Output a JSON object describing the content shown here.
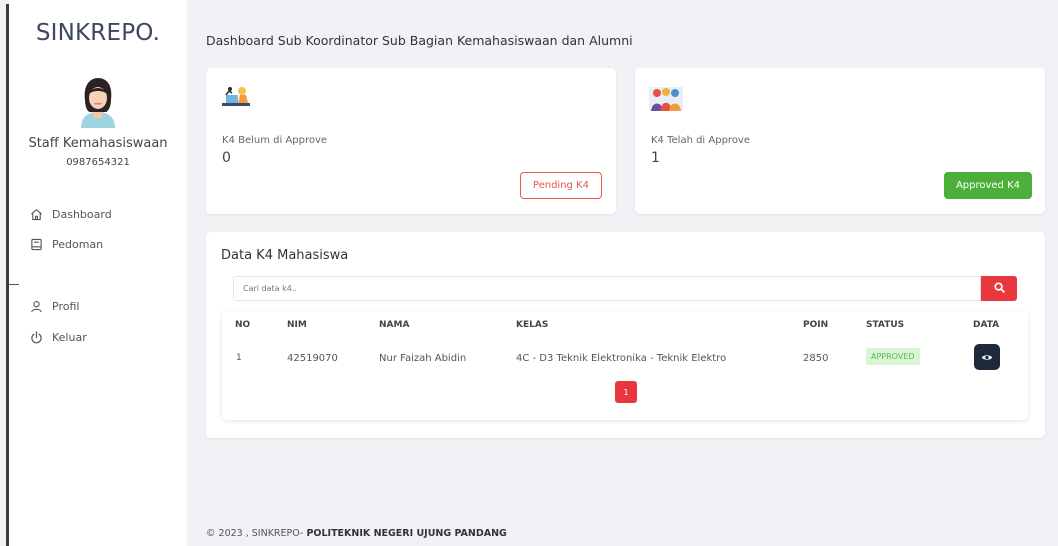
{
  "sidebar": {
    "brand": "SINKREPO.",
    "user_name": "Staff Kemahasiswaan",
    "user_phone": "0987654321",
    "nav": [
      {
        "label": "Dashboard",
        "icon": "home-icon"
      },
      {
        "label": "Pedoman",
        "icon": "book-icon"
      },
      {
        "label": "Profil",
        "icon": "user-icon"
      },
      {
        "label": "Keluar",
        "icon": "power-icon"
      }
    ]
  },
  "page_title": "Dashboard Sub Koordinator Sub Bagian Kemahasiswaan dan Alumni",
  "stats": {
    "pending": {
      "label": "K4 Belum di Approve",
      "value": "0",
      "button": "Pending K4"
    },
    "approved": {
      "label": "K4 Telah di Approve",
      "value": "1",
      "button": "Approved K4"
    }
  },
  "table": {
    "title": "Data K4 Mahasiswa",
    "search_placeholder": "Cari data k4..",
    "headers": [
      "NO",
      "NIM",
      "NAMA",
      "KELAS",
      "POIN",
      "STATUS",
      "DATA"
    ],
    "rows": [
      {
        "no": "1",
        "nim": "42519070",
        "nama": "Nur Faizah Abidin",
        "kelas": "4C - D3 Teknik Elektronika - Teknik Elektro",
        "poin": "2850",
        "status": "APPROVED"
      }
    ],
    "page": "1"
  },
  "footer": {
    "text": "© 2023 , SINKREPO- ",
    "org": "POLITEKNIK NEGERI UJUNG PANDANG"
  },
  "colors": {
    "accent_red": "#e9383d",
    "approved_green": "#4caf3a",
    "dark_button": "#1e2a3a",
    "background": "#f1f2f5"
  }
}
